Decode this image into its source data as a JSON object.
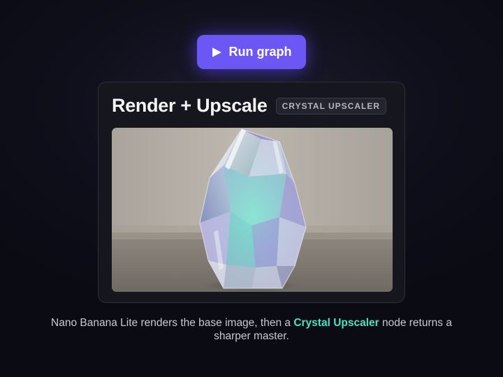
{
  "run_button": {
    "label": "Run graph",
    "icon": "play-icon",
    "color": "#6c57f4"
  },
  "card": {
    "title": "Render + Upscale",
    "badge": "CRYSTAL UPSCALER",
    "image_alt": "Faceted crystal gem render"
  },
  "caption": {
    "before": "Nano Banana Lite renders the base image, then a ",
    "highlight": "Crystal Upscaler",
    "after": " node returns a sharper master.",
    "highlight_color": "#4fe0c2"
  }
}
